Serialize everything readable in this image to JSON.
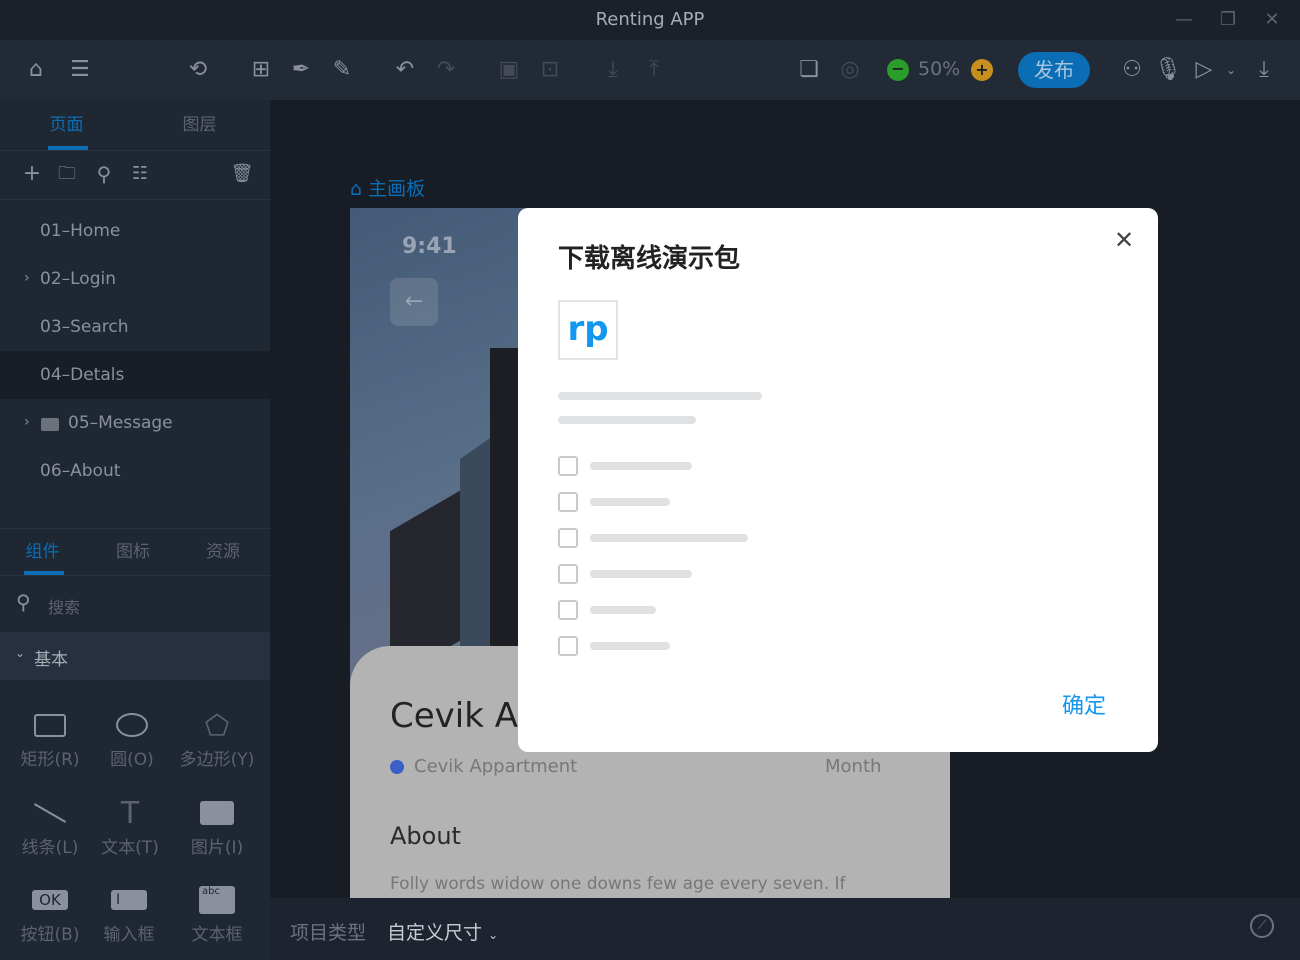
{
  "window": {
    "title": "Renting APP"
  },
  "toolbar": {
    "zoom": "50%",
    "publish": "发布"
  },
  "sidebar": {
    "tabs": [
      "页面",
      "图层"
    ],
    "pages": [
      "01–Home",
      "02–Login",
      "03–Search",
      "04–Detals",
      "05–Message",
      "06–About"
    ],
    "lib_tabs": [
      "组件",
      "图标",
      "资源"
    ],
    "search_placeholder": "搜索",
    "group": "基本",
    "components": [
      "矩形(R)",
      "圆(O)",
      "多边形(Y)",
      "线条(L)",
      "文本(T)",
      "图片(I)",
      "按钮(B)",
      "输入框",
      "文本框"
    ]
  },
  "canvas": {
    "board_title": "主画板"
  },
  "phone": {
    "time": "9:41",
    "title": "Cevik Ap",
    "location": "Cevik Appartment",
    "period": "Month",
    "about": "About",
    "body": "Folly words widow one downs few age every seven. If",
    "ok_label": "OK",
    "abc_label": "abc"
  },
  "dialog": {
    "title": "下载离线演示包",
    "logo": "rp",
    "confirm": "确定"
  },
  "bottom": {
    "label": "项目类型",
    "value": "自定义尺寸"
  }
}
